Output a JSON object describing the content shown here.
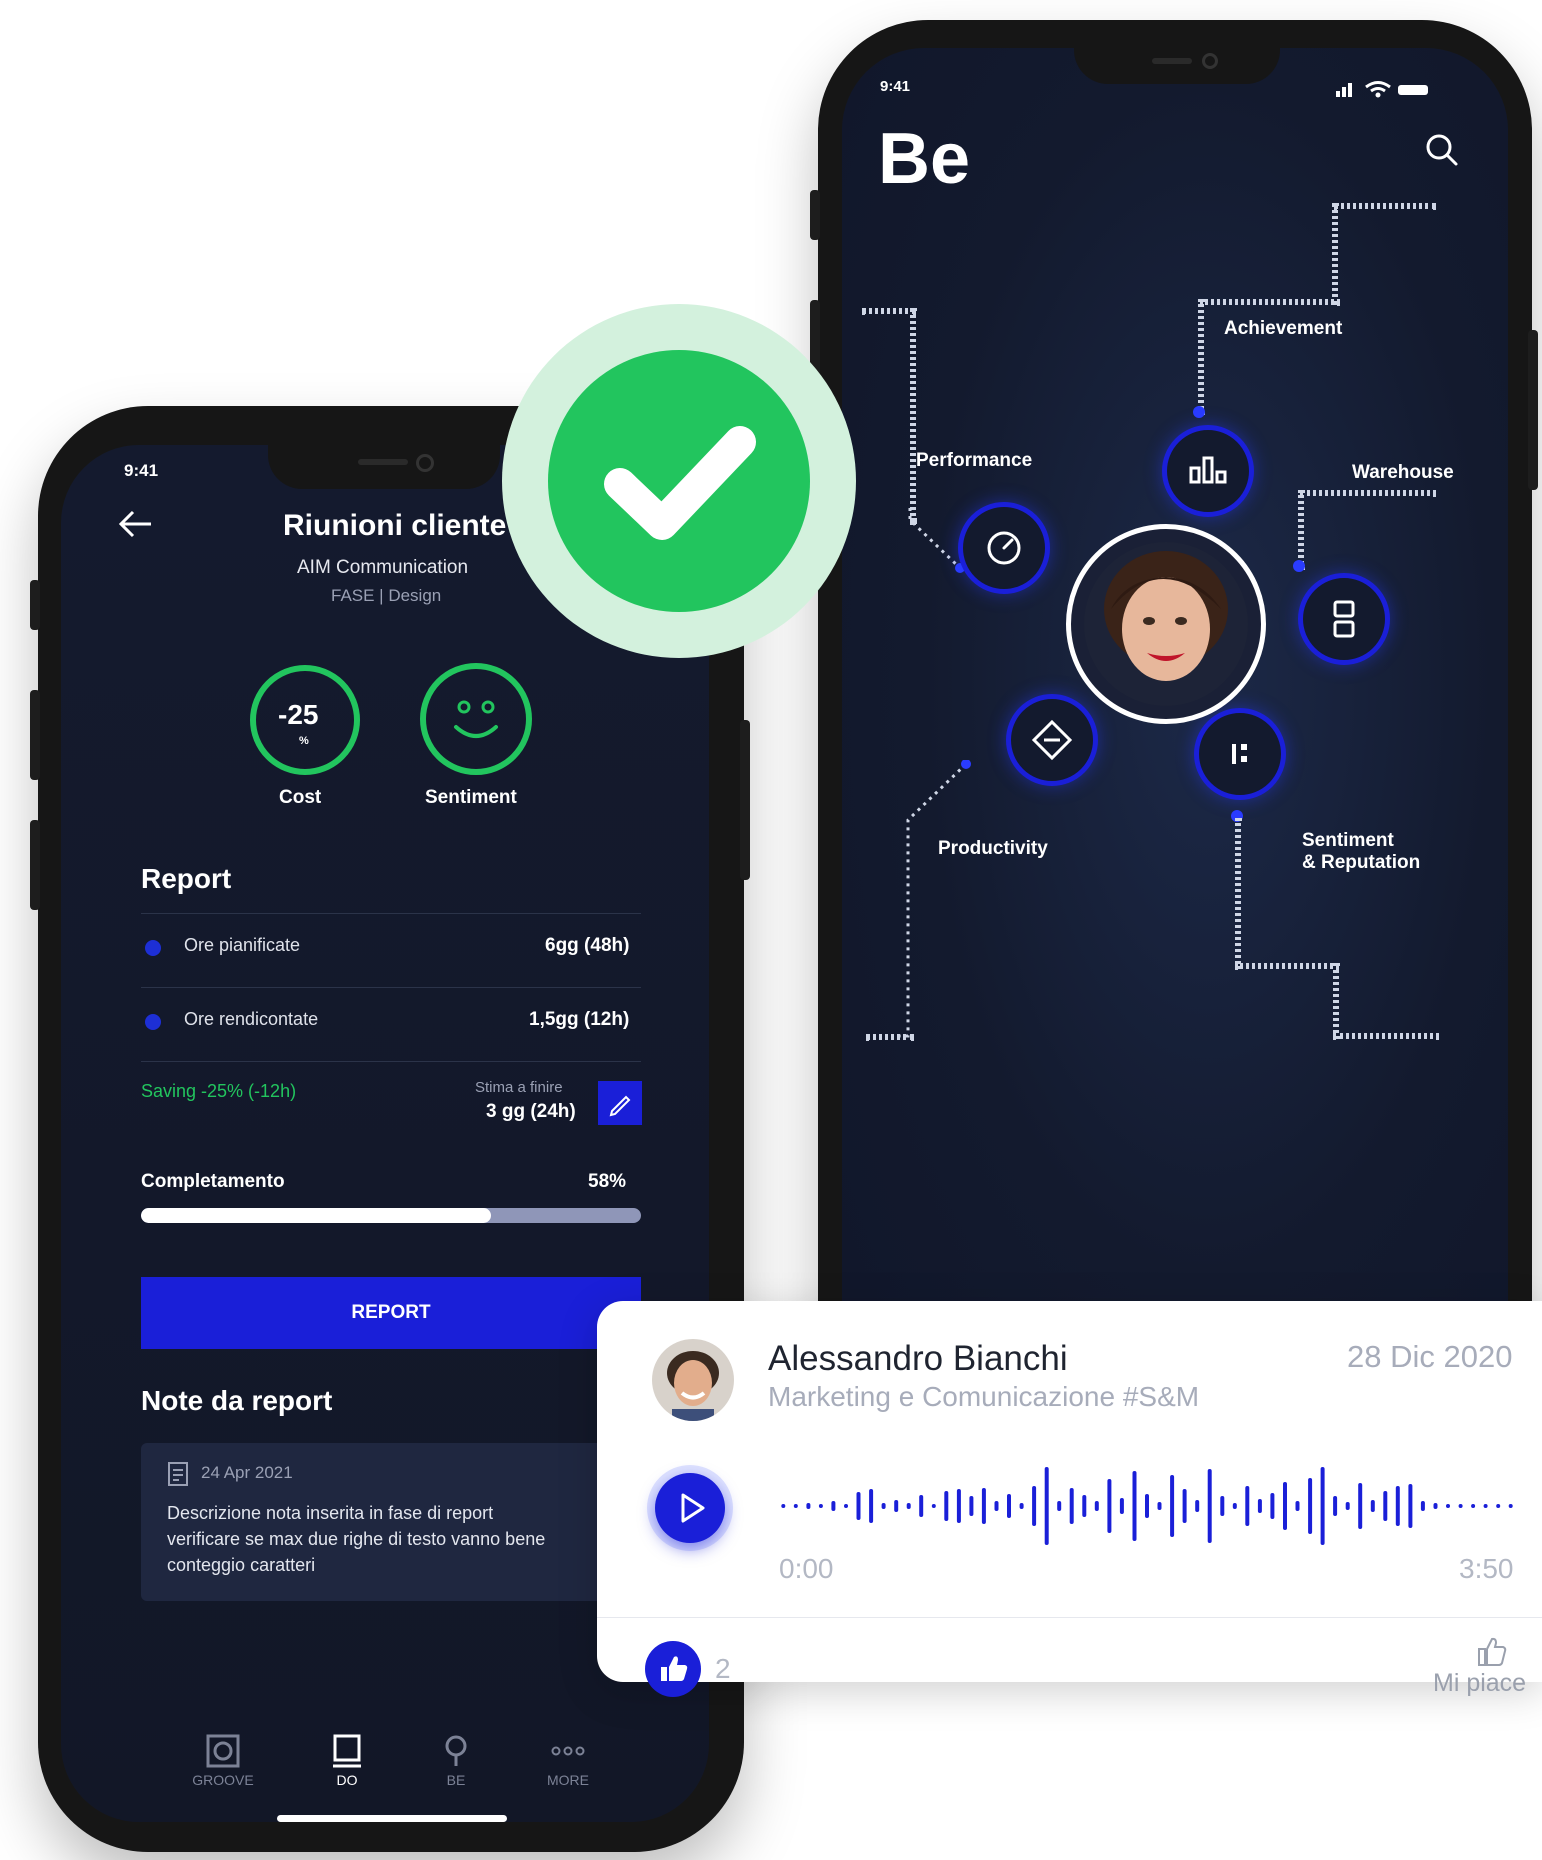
{
  "left_phone": {
    "status_time": "9:41",
    "title": "Riunioni cliente",
    "company": "AIM Communication",
    "phase": "FASE | Design",
    "cost": {
      "value": "-25",
      "unit": "%",
      "label": "Cost"
    },
    "sentiment": {
      "label": "Sentiment"
    },
    "report": {
      "heading": "Report",
      "rows": [
        {
          "label": "Ore pianificate",
          "value": "6gg (48h)"
        },
        {
          "label": "Ore rendicontate",
          "value": "1,5gg (12h)"
        }
      ],
      "saving": "Saving -25% (-12h)",
      "estimate_label": "Stima a finire",
      "estimate_value": "3 gg (24h)"
    },
    "completion": {
      "label": "Completamento",
      "value_text": "58%",
      "progress": 0.7
    },
    "report_button": "REPORT",
    "notes": {
      "heading": "Note da report",
      "date": "24 Apr 2021",
      "text_line1": "Descrizione nota inserita in fase di report",
      "text_line2": "verificare se max due righe di testo vanno bene",
      "text_line3": "conteggio caratteri"
    },
    "nav": [
      "GROOVE",
      "DO",
      "BE",
      "MORE"
    ]
  },
  "right_phone": {
    "status_time": "9:41",
    "title": "Be",
    "labels": {
      "achievement": "Achievement",
      "performance": "Performance",
      "warehouse": "Warehouse",
      "productivity": "Productivity",
      "sentiment_line1": "Sentiment",
      "sentiment_line2": "& Reputation"
    }
  },
  "card": {
    "name": "Alessandro Bianchi",
    "subtitle": "Marketing e Comunicazione #S&M",
    "date": "28 Dic 2020",
    "time_start": "0:00",
    "time_end": "3:50",
    "likes": "2",
    "like_label": "Mi piace"
  },
  "colors": {
    "accent_blue": "#1a1fd8",
    "green": "#22c55e",
    "navy": "#131a2e"
  }
}
